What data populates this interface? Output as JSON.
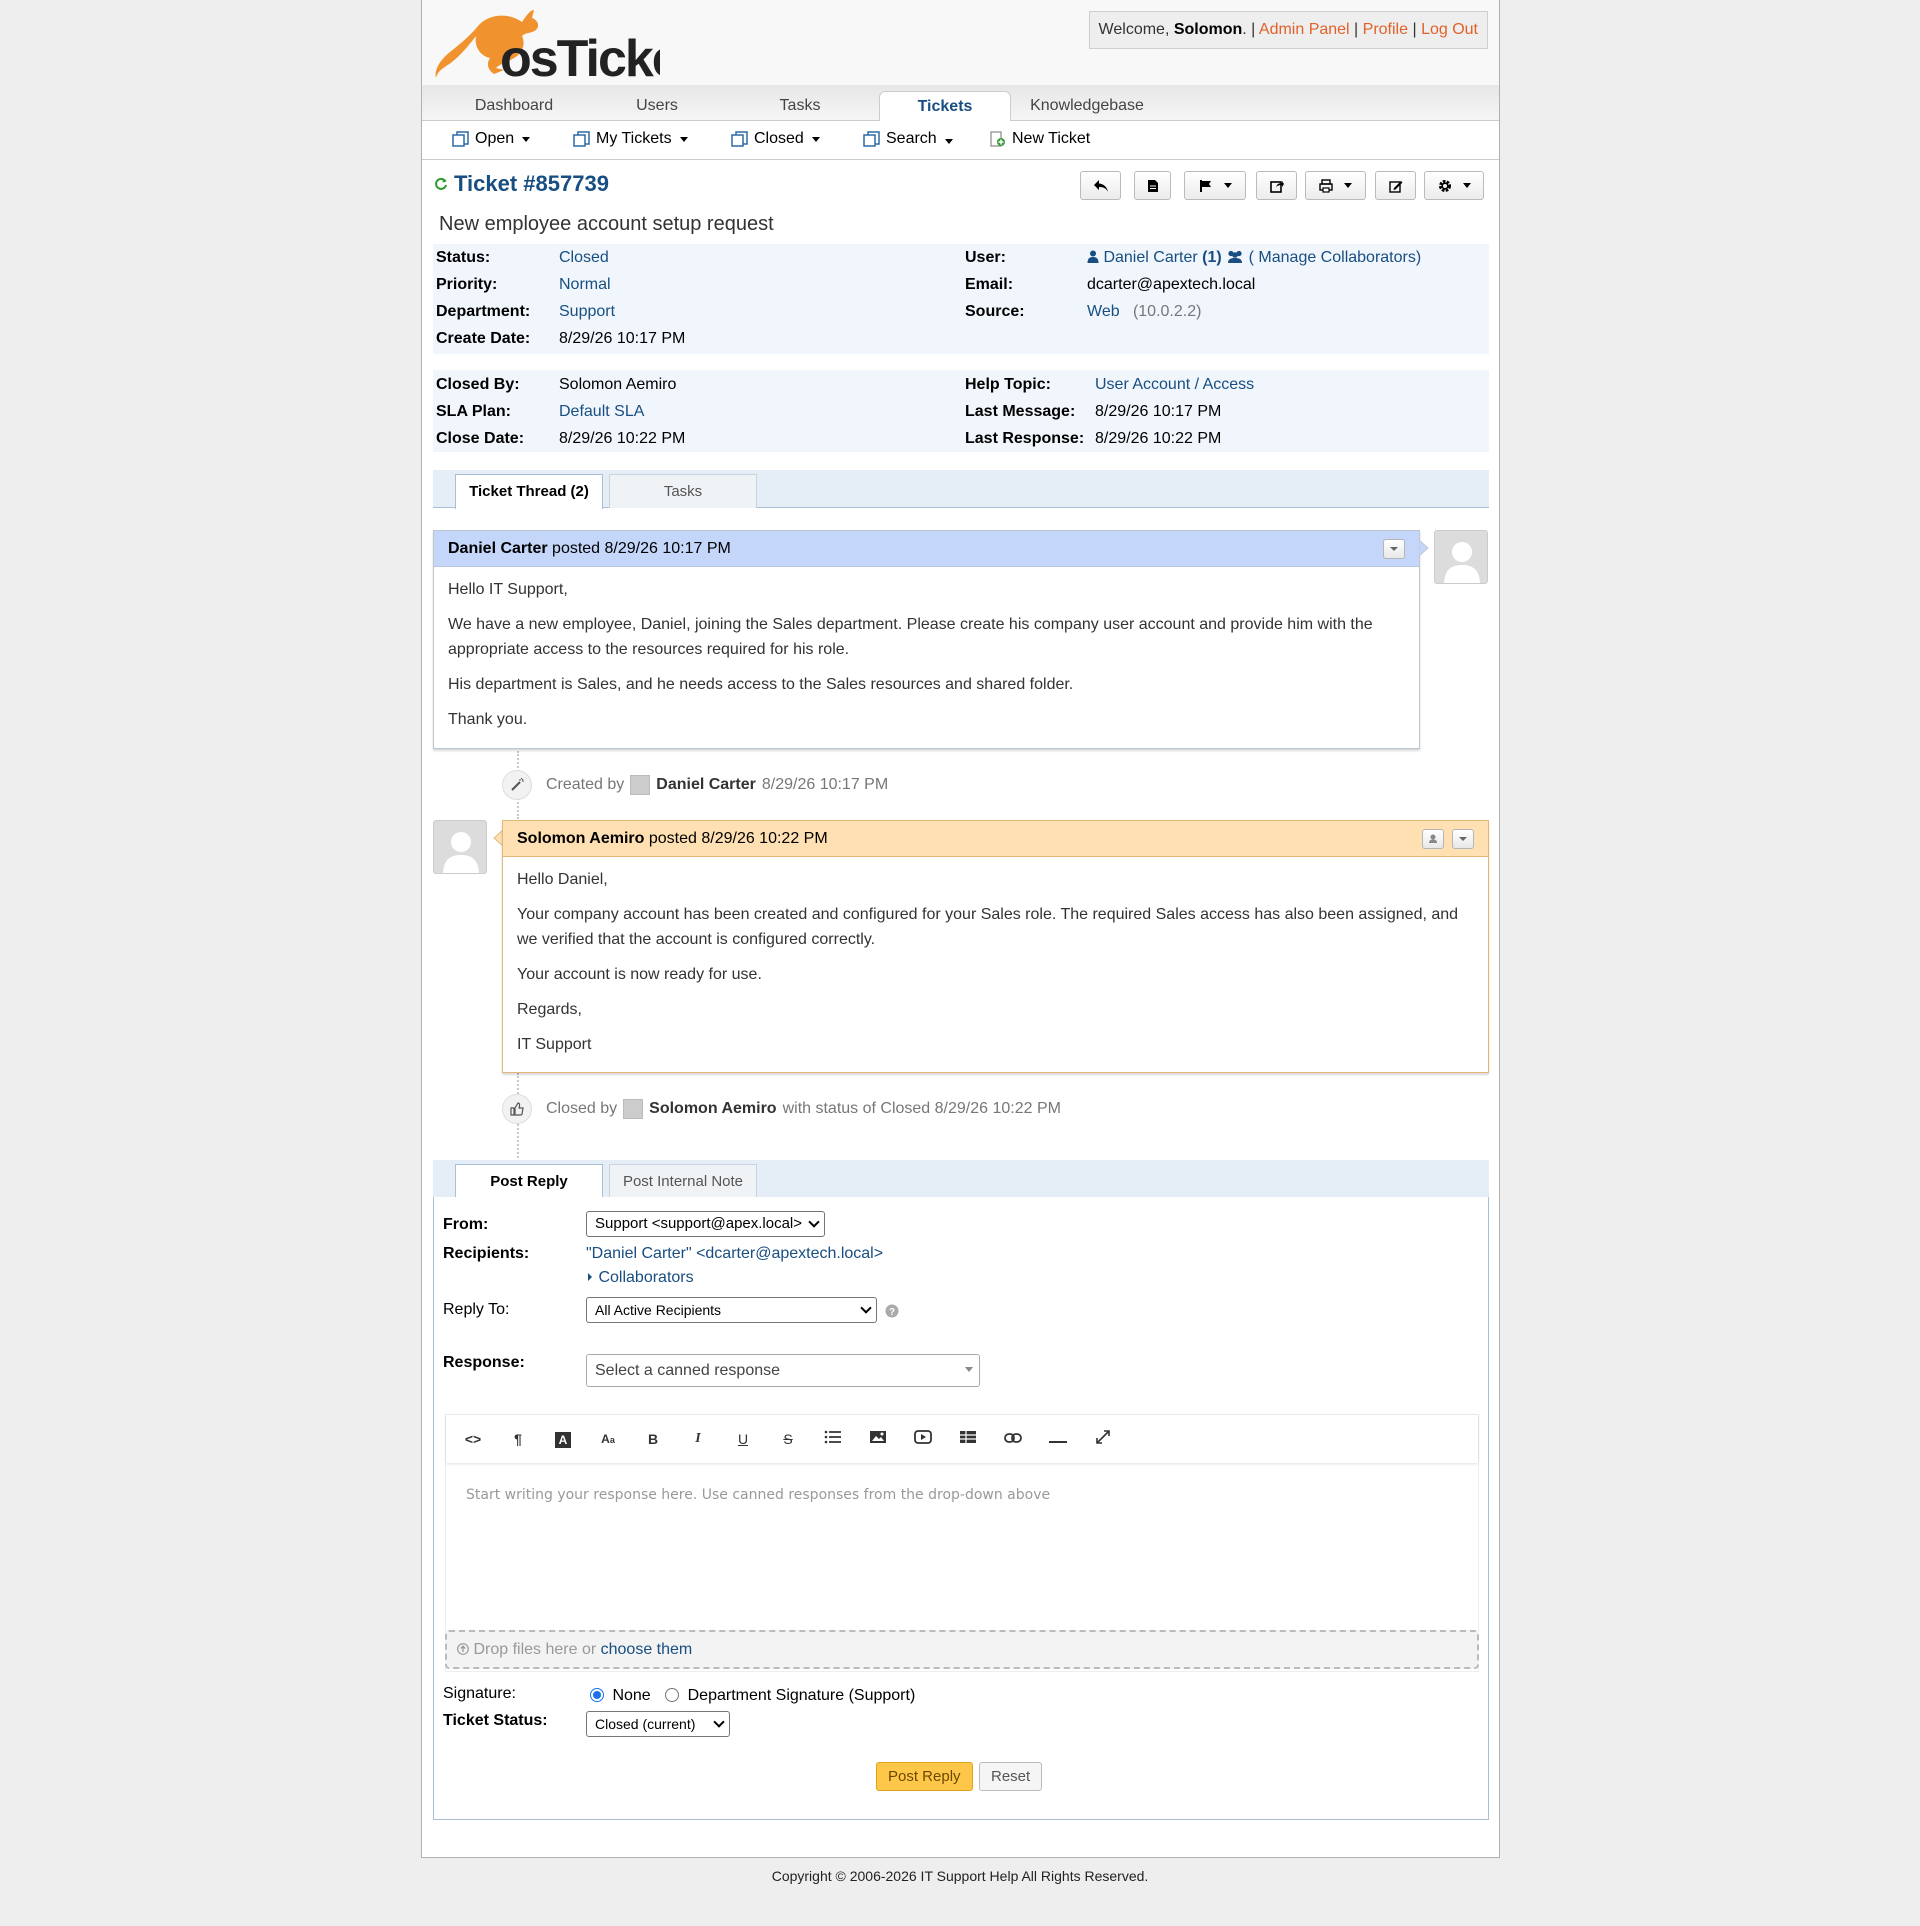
{
  "header": {
    "logo_text": "osTicket",
    "welcome_prefix": "Welcome, ",
    "user_name": "Solomon",
    "welcome_suffix": ".",
    "sep": " | ",
    "admin_panel": "Admin Panel",
    "profile": "Profile",
    "logout": "Log Out"
  },
  "nav": {
    "tabs": [
      "Dashboard",
      "Users",
      "Tasks",
      "Tickets",
      "Knowledgebase"
    ],
    "active": "Tickets"
  },
  "subnav": {
    "open": "Open",
    "my_tickets": "My Tickets",
    "closed": "Closed",
    "search": "Search",
    "new_ticket": "New Ticket"
  },
  "ticket": {
    "number": "Ticket #857739",
    "subject": "New employee account setup request"
  },
  "info": {
    "status_label": "Status:",
    "status": "Closed",
    "priority_label": "Priority:",
    "priority": "Normal",
    "department_label": "Department:",
    "department": "Support",
    "create_date_label": "Create Date:",
    "create_date": "8/29/26 10:17 PM",
    "user_label": "User:",
    "user": "Daniel Carter",
    "user_count": "(1)",
    "manage_collaborators": "( Manage Collaborators)",
    "email_label": "Email:",
    "email": "dcarter@apextech.local",
    "source_label": "Source:",
    "source": "Web",
    "source_ip": "(10.0.2.2)",
    "closed_by_label": "Closed By:",
    "closed_by": "Solomon Aemiro",
    "sla_label": "SLA Plan:",
    "sla": "Default SLA",
    "close_date_label": "Close Date:",
    "close_date": "8/29/26 10:22 PM",
    "help_topic_label": "Help Topic:",
    "help_topic": "User Account / Access",
    "last_message_label": "Last Message:",
    "last_message": "8/29/26 10:17 PM",
    "last_response_label": "Last Response:",
    "last_response": "8/29/26 10:22 PM"
  },
  "thread_tabs": {
    "thread": "Ticket Thread (2)",
    "tasks": "Tasks"
  },
  "thread": {
    "entry1": {
      "author": "Daniel Carter",
      "posted": " posted 8/29/26 10:17 PM",
      "p1": "Hello IT Support,",
      "p2": "We have a new employee, Daniel, joining the Sales department. Please create his company user account and provide him with the appropriate access to the resources required for his role.",
      "p3": "His department is Sales, and he needs access to the Sales resources and shared folder.",
      "p4": "Thank you."
    },
    "event1": {
      "prefix": "Created by",
      "who": "Daniel Carter",
      "when": "8/29/26 10:17 PM"
    },
    "entry2": {
      "author": "Solomon Aemiro",
      "posted": " posted 8/29/26 10:22 PM",
      "p1": "Hello Daniel,",
      "p2": "Your company account has been created and configured for your Sales role. The required Sales access has also been assigned, and we verified that the account is configured correctly.",
      "p3": "Your account is now ready for use.",
      "p4": "Regards,",
      "p5": "IT Support"
    },
    "event2": {
      "prefix": "Closed by",
      "who": "Solomon Aemiro",
      "suffix": "with status of Closed 8/29/26 10:22 PM"
    }
  },
  "reply_tabs": {
    "post_reply": "Post Reply",
    "internal_note": "Post Internal Note"
  },
  "reply": {
    "from_label": "From:",
    "from_value": "Support <support@apex.local>",
    "recipients_label": "Recipients:",
    "recipient": "\"Daniel Carter\" <dcarter@apextech.local>",
    "collaborators": "Collaborators",
    "reply_to_label": "Reply To:",
    "reply_to_value": "All Active Recipients",
    "response_label": "Response:",
    "response_placeholder": "Select a canned response",
    "editor_placeholder": "Start writing your response here. Use canned responses from the drop-down above",
    "drop_text": "Drop files here or ",
    "choose_them": "choose them",
    "signature_label": "Signature:",
    "sig_none": "None",
    "sig_dept": "Department Signature (Support)",
    "status_label": "Ticket Status:",
    "status_value": "Closed (current)",
    "post_button": "Post Reply",
    "reset_button": "Reset"
  },
  "footer": {
    "copyright": "Copyright © 2006-2026 IT Support Help All Rights Reserved."
  },
  "colors": {
    "link": "#184e81",
    "orange": "#e0622a",
    "client_header": "#c4d7fa",
    "staff_header": "#ffe0b3",
    "primary_button": "#ffc74a"
  }
}
